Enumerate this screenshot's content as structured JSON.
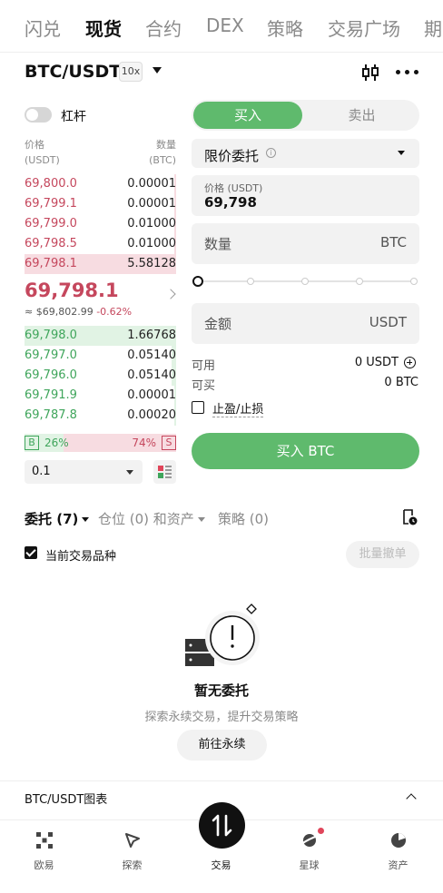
{
  "top_tabs": [
    "闪兑",
    "现货",
    "合约",
    "DEX",
    "策略",
    "交易广场",
    "期"
  ],
  "active_top_tab": "现货",
  "pair": {
    "symbol": "BTC/USDT",
    "leverage": "10x"
  },
  "leverage_toggle": {
    "label": "杠杆",
    "on": false
  },
  "orderbook": {
    "price_header": "价格",
    "price_unit": "(USDT)",
    "qty_header": "数量",
    "qty_unit": "(BTC)",
    "asks": [
      {
        "price": "69,800.0",
        "qty": "0.00001",
        "depth": 0.01
      },
      {
        "price": "69,799.1",
        "qty": "0.00001",
        "depth": 0.01
      },
      {
        "price": "69,799.0",
        "qty": "0.01000",
        "depth": 0.01
      },
      {
        "price": "69,798.5",
        "qty": "0.01000",
        "depth": 0.01
      },
      {
        "price": "69,798.1",
        "qty": "5.58128",
        "depth": 1.0
      }
    ],
    "last_price": "69,798.1",
    "last_usd": "≈ $69,802.99",
    "last_change": "-0.62%",
    "bids": [
      {
        "price": "69,798.0",
        "qty": "1.66768",
        "depth": 1.0
      },
      {
        "price": "69,797.0",
        "qty": "0.05140",
        "depth": 0.03
      },
      {
        "price": "69,796.0",
        "qty": "0.05140",
        "depth": 0.03
      },
      {
        "price": "69,791.9",
        "qty": "0.00001",
        "depth": 0.01
      },
      {
        "price": "69,787.8",
        "qty": "0.00020",
        "depth": 0.01
      }
    ],
    "ratio": {
      "buy_label": "B",
      "buy_pct": "26%",
      "sell_pct": "74%",
      "sell_label": "S",
      "buy_fraction": 0.26
    },
    "step": "0.1"
  },
  "form": {
    "buy_tab": "买入",
    "sell_tab": "卖出",
    "order_type": "限价委托",
    "price_label": "价格 (USDT)",
    "price_value": "69,798",
    "qty_label": "数量",
    "qty_unit": "BTC",
    "slider_percent": 0,
    "amount_label": "金额",
    "amount_unit": "USDT",
    "available_label": "可用",
    "available_value": "0 USDT",
    "can_buy_label": "可买",
    "can_buy_value": "0 BTC",
    "tpsl_label": "止盈/止损",
    "submit": "买入 BTC"
  },
  "orders": {
    "tabs": [
      {
        "label": "委托 (7)",
        "active": true,
        "dropdown": true
      },
      {
        "label": "仓位 (0) 和资产",
        "active": false,
        "dropdown": true
      },
      {
        "label": "策略 (0)",
        "active": false,
        "dropdown": false
      }
    ],
    "current_pair_filter": "当前交易品种",
    "batch_cancel": "批量撤单",
    "empty_title": "暂无委托",
    "empty_subtitle": "探索永续交易，提升交易策略",
    "goto_button": "前往永续"
  },
  "chart_bar": {
    "title": "BTC/USDT图表"
  },
  "bottom_nav": [
    {
      "label": "欧易",
      "icon": "okx-logo-icon"
    },
    {
      "label": "探索",
      "icon": "explore-icon"
    },
    {
      "label": "交易",
      "icon": "trade-icon",
      "active": true
    },
    {
      "label": "星球",
      "icon": "planet-icon"
    },
    {
      "label": "资产",
      "icon": "assets-pie-icon"
    }
  ],
  "colors": {
    "buy": "#5fba6d",
    "ask": "#c5475d",
    "bid": "#3fa55b"
  }
}
